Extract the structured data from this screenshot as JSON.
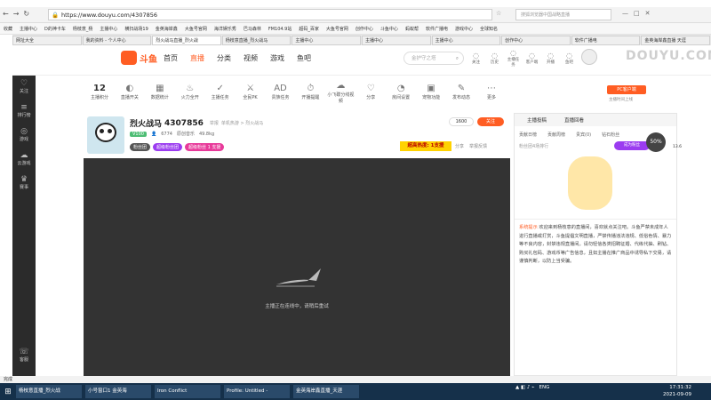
{
  "browser": {
    "url": "https://www.douyu.com/4307856",
    "search_placeholder": "搜狐浏览器中国战略直播",
    "window_ctrl": [
      "—",
      "□",
      "✕"
    ]
  },
  "bookmarks": [
    "收藏",
    "主播中心",
    "D的神卡车",
    "杨枝意_杨",
    "主播中心",
    "横扫战场19",
    "金英海岸鑫",
    "大鱼号官网",
    "海洋娱乐秀",
    "巴马森林",
    "FM104.9站",
    "超码_百家",
    "大鱼号官网",
    "创作中心",
    "斗鱼中心",
    "蚂蚁帮",
    "软件广播电",
    "游戏中心",
    "全球知名"
  ],
  "tabs": [
    "网址大全",
    "我的资料 - 个人中心",
    "烈火战马直播_烈火战",
    "杨枝意直播_烈火战马",
    "主播中心",
    "主播中心",
    "主播中心",
    "创作中心",
    "软件广播电",
    "金英海岸鑫直播 天涯"
  ],
  "site": {
    "logo": "斗鱼",
    "nav": [
      "首页",
      "直播",
      "分类",
      "视频",
      "游戏",
      "鱼吧"
    ],
    "search_placeholder": "金护守之塔",
    "header_icons": [
      "关注",
      "历史",
      "主播任务",
      "客户端",
      "开播",
      "鱼吧"
    ]
  },
  "brand_watermark": "DOUYU.COM",
  "left_bar": [
    "关注",
    "排行榜",
    "游戏",
    "云游戏",
    "赛事",
    "客服"
  ],
  "icon_row": [
    {
      "g": "12",
      "l": "主播积分"
    },
    {
      "g": "◐",
      "l": "直播开关"
    },
    {
      "g": "▦",
      "l": "数据统计"
    },
    {
      "g": "♨",
      "l": "火力全开"
    },
    {
      "g": "✓",
      "l": "主播任务"
    },
    {
      "g": "⚔",
      "l": "全民PK"
    },
    {
      "g": "AD",
      "l": "贵族任务"
    },
    {
      "g": "⏱",
      "l": "开播提醒"
    },
    {
      "g": "☁",
      "l": "小飞碟分线视频"
    },
    {
      "g": "♡",
      "l": "分享"
    },
    {
      "g": "◔",
      "l": "房间设置"
    },
    {
      "g": "▣",
      "l": "宠物功能"
    },
    {
      "g": "✎",
      "l": "发布动态"
    },
    {
      "g": "⋯",
      "l": "更多"
    }
  ],
  "pc_badge": "PC客户端",
  "pc_sub": "主播时间上线",
  "room": {
    "name": "烈火战马",
    "id": "4307856",
    "tag1": "举报",
    "tag2": "单机热游 > 烈火战马",
    "level": "V100",
    "followers": "6774",
    "category": "原创音乐",
    "fans": "49.8kg",
    "btn_follow": "关注",
    "follow_count": "1600",
    "anchor_badge": "粉丝团",
    "fan_club": "超级粉丝团",
    "extra": "超级粉丝 1 支援",
    "share": "分享",
    "report": "举报反馈",
    "hot": "超高热度: 1支援"
  },
  "player": {
    "status": "主播正在连线中，请稍后重试"
  },
  "rpanel": {
    "tabs": [
      "主播投稿",
      "直播回看"
    ],
    "subtabs": [
      "贡献日榜",
      "贡献周榜",
      "贵宾(0)",
      "钻石粉丝"
    ],
    "rank_hint": "粉丝团4场排行",
    "speed": "50%",
    "speed_sub": "13.6"
  },
  "notice": {
    "title": "系统提示",
    "body": "欢迎来到杨枝意的直播间，喜欢就点关注吧。斗鱼严禁未成年人进行直播或打赏，斗鱼提倡文明直播，严禁传播违法违规、低俗色情、暴力等不良内容，封禁违规直播间。请勿轻信各类招聘征婚、代练代抽、刷钻、购买礼包码、游戏币等广告信息，且如主播在推广商品中诱导私下交易，请谨慎判断，以防上当受骗。"
  },
  "taskbar": {
    "items": [
      "杨枝意直播_烈火战",
      "小号窗口1 金英海",
      "Iron Conflict",
      "Profile: Untitled -",
      "金英海岸鑫直播_天涯"
    ],
    "time": "17:31:32",
    "date": "2021-09-09",
    "lang": "ENG"
  }
}
